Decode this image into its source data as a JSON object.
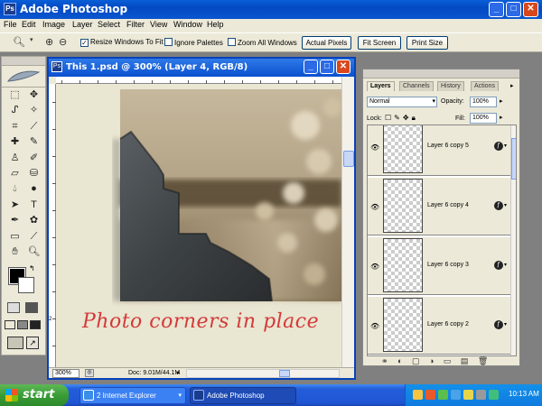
{
  "app": {
    "title": "Adobe Photoshop"
  },
  "menu": [
    "File",
    "Edit",
    "Image",
    "Layer",
    "Select",
    "Filter",
    "View",
    "Window",
    "Help"
  ],
  "options": {
    "resize_windows": "Resize Windows To Fit",
    "ignore_palettes": "Ignore Palettes",
    "zoom_all": "Zoom All Windows",
    "actual_pixels": "Actual Pixels",
    "fit_screen": "Fit Screen",
    "print_size": "Print Size"
  },
  "document": {
    "title": "This 1.psd @ 300% (Layer 4, RGB/8)",
    "caption": "Photo corners in place",
    "zoom": "300%",
    "doc_info": "Doc: 9.01M/44.1M",
    "ruler_v_label": "2"
  },
  "layers_panel": {
    "tabs": [
      "Layers",
      "Channels",
      "History",
      "Actions"
    ],
    "blend_mode": "Normal",
    "opacity_label": "Opacity:",
    "opacity": "100%",
    "lock_label": "Lock:",
    "fill_label": "Fill:",
    "fill": "100%",
    "layers": [
      "Layer 6 copy 5",
      "Layer 6 copy 4",
      "Layer 6 copy 3",
      "Layer 6 copy 2"
    ]
  },
  "taskbar": {
    "start": "start",
    "tasks": [
      "2 Internet Explorer",
      "Adobe Photoshop"
    ],
    "clock": "10:13 AM"
  },
  "colors": {
    "caption": "#d43a3a",
    "titlebar": "#0a50cf",
    "start": "#3a9d37"
  }
}
